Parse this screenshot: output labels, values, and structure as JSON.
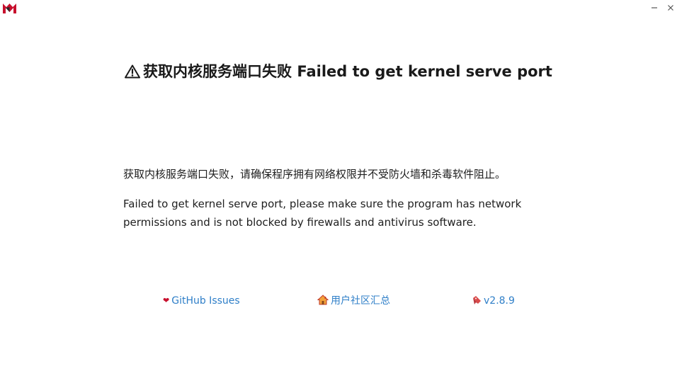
{
  "titlebar": {
    "logo_icon": "app-logo-icon",
    "minimize_icon": "minimize-icon",
    "close_icon": "close-icon"
  },
  "error": {
    "icon": "warning-icon",
    "title": "获取内核服务端口失败 Failed to get kernel serve port",
    "message_zh": "获取内核服务端口失败，请确保程序拥有网络权限并不受防火墙和杀毒软件阻止。",
    "message_en": "Failed to get kernel serve port, please make sure the program has network permissions and is not blocked by firewalls and antivirus software."
  },
  "footer": {
    "github": {
      "icon": "heart-icon",
      "label": "GitHub Issues"
    },
    "community": {
      "icon": "house-icon",
      "label": "用户社区汇总"
    },
    "version": {
      "icon": "bookmark-icon",
      "label": "v2.8.9"
    }
  },
  "colors": {
    "link": "#2f7fc8",
    "logo": "#c8102e",
    "background": "#ffffff"
  }
}
